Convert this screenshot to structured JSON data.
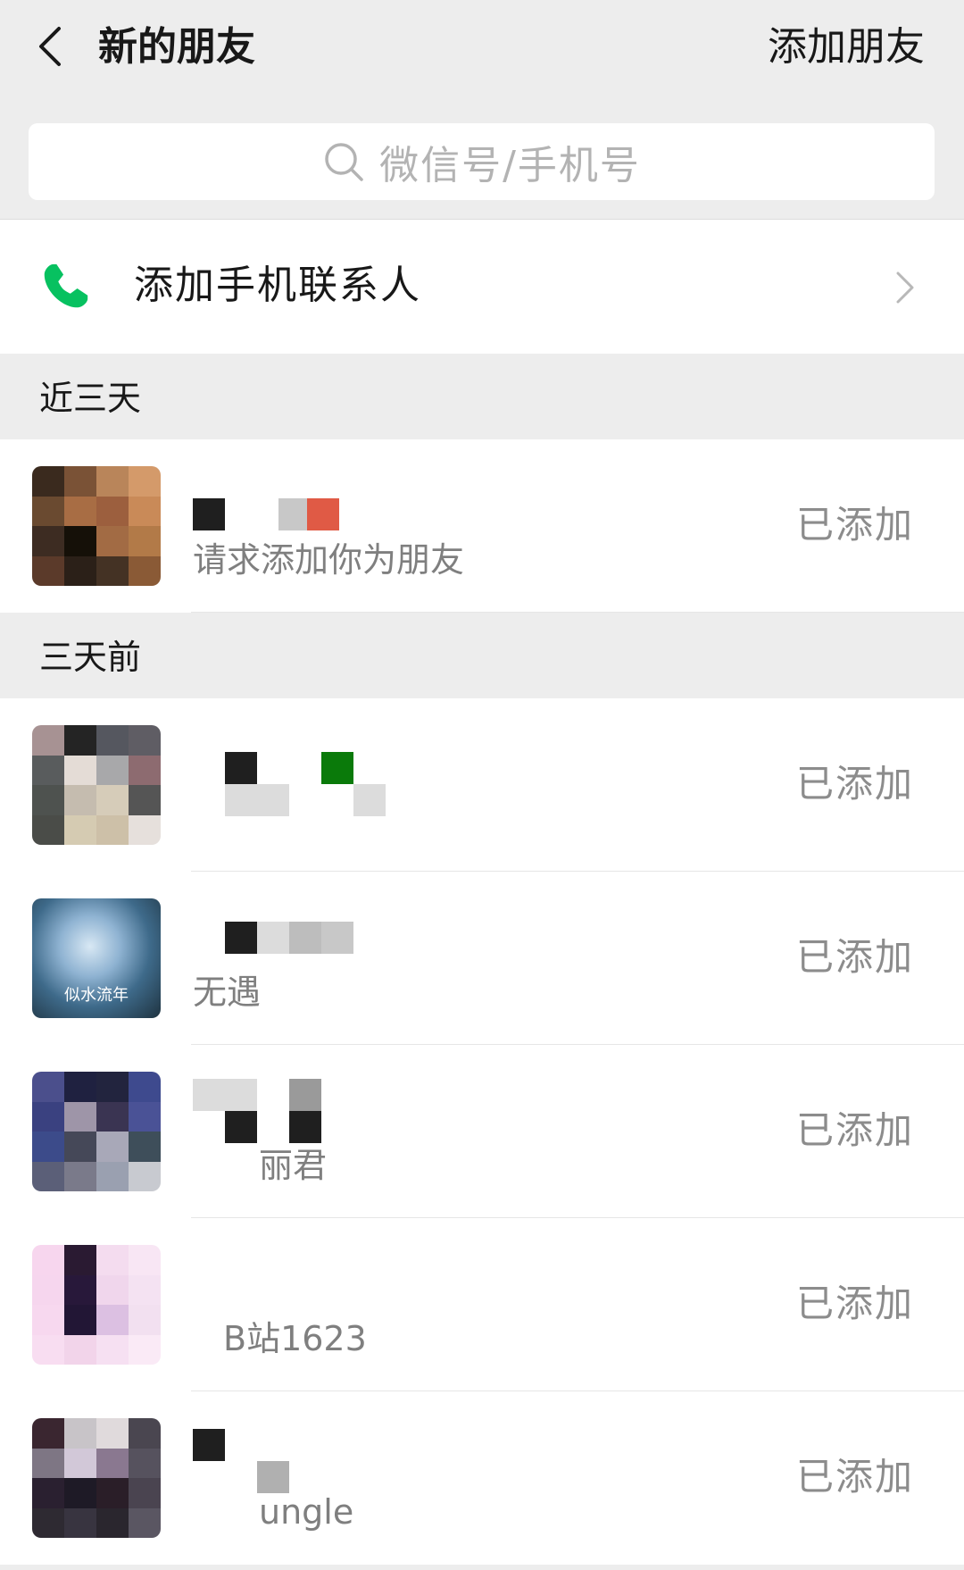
{
  "header": {
    "title": "新的朋友",
    "add_friend_label": "添加朋友"
  },
  "search": {
    "placeholder": "微信号/手机号"
  },
  "phone_contacts": {
    "label": "添加手机联系人"
  },
  "sections": [
    {
      "label": "近三天",
      "items": [
        {
          "name": "",
          "subtitle": "请求添加你为朋友",
          "status": "已添加"
        }
      ]
    },
    {
      "label": "三天前",
      "items": [
        {
          "name": "",
          "subtitle": "",
          "status": "已添加"
        },
        {
          "name": "",
          "subtitle": "无遇",
          "status": "已添加",
          "avatar_caption": "似水流年"
        },
        {
          "name": "",
          "subtitle": "丽君",
          "status": "已添加"
        },
        {
          "name": "",
          "subtitle": "B站1623",
          "status": "已添加"
        },
        {
          "name": "",
          "subtitle": "ungle",
          "status": "已添加"
        }
      ]
    }
  ],
  "colors": {
    "background": "#ededed",
    "surface": "#ffffff",
    "phone_icon": "#07c160",
    "status_text": "#8c8c8c"
  },
  "icons": {
    "back": "chevron-left-icon",
    "search": "search-icon",
    "phone": "phone-icon",
    "chevron": "chevron-right-icon"
  }
}
